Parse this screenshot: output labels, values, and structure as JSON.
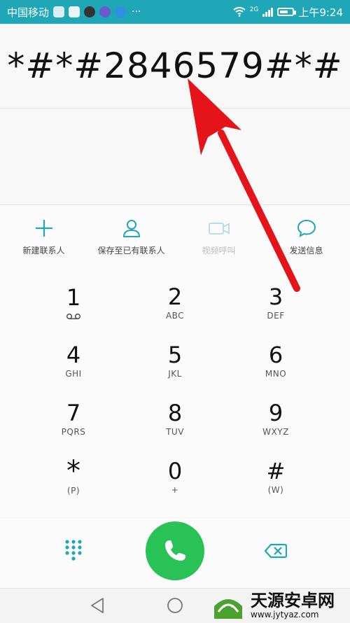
{
  "status_bar": {
    "carrier": "中国移动",
    "network_label": "2G",
    "time": "上午9:24",
    "more": "···",
    "battery_level": 0.7,
    "icons": [
      "voicemail-app-icon",
      "photo-app-icon",
      "tiktok-app-icon",
      "music-app-icon",
      "browser-app-icon",
      "wifi-icon",
      "signal-icon",
      "battery-icon"
    ]
  },
  "dialer": {
    "number": "*#*#2846579#*#"
  },
  "actions": [
    {
      "label": "新建联系人",
      "icon": "plus-icon",
      "enabled": true
    },
    {
      "label": "保存至已有联系人",
      "icon": "person-icon",
      "enabled": true
    },
    {
      "label": "视频呼叫",
      "icon": "video-camera-icon",
      "enabled": false
    },
    {
      "label": "发送信息",
      "icon": "message-bubble-icon",
      "enabled": true
    }
  ],
  "keys": [
    {
      "digit": "1",
      "sub": "voicemail-icon"
    },
    {
      "digit": "2",
      "sub": "ABC"
    },
    {
      "digit": "3",
      "sub": "DEF"
    },
    {
      "digit": "4",
      "sub": "GHI"
    },
    {
      "digit": "5",
      "sub": "JKL"
    },
    {
      "digit": "6",
      "sub": "MNO"
    },
    {
      "digit": "7",
      "sub": "PQRS"
    },
    {
      "digit": "8",
      "sub": "TUV"
    },
    {
      "digit": "9",
      "sub": "WXYZ"
    },
    {
      "digit": "*",
      "sub": "(P)"
    },
    {
      "digit": "0",
      "sub": "+"
    },
    {
      "digit": "#",
      "sub": "(W)"
    }
  ],
  "bottom_bar": {
    "left_icon": "dialpad-icon",
    "call_icon": "phone-icon",
    "right_icon": "backspace-icon"
  },
  "colors": {
    "status_bar": "#1fa7b7",
    "accent": "#1fa7b7",
    "call_button": "#28c257",
    "annotation_arrow": "#e5141b"
  },
  "watermark": {
    "title": "天源安卓网",
    "url": "www.jytyaz.com"
  }
}
